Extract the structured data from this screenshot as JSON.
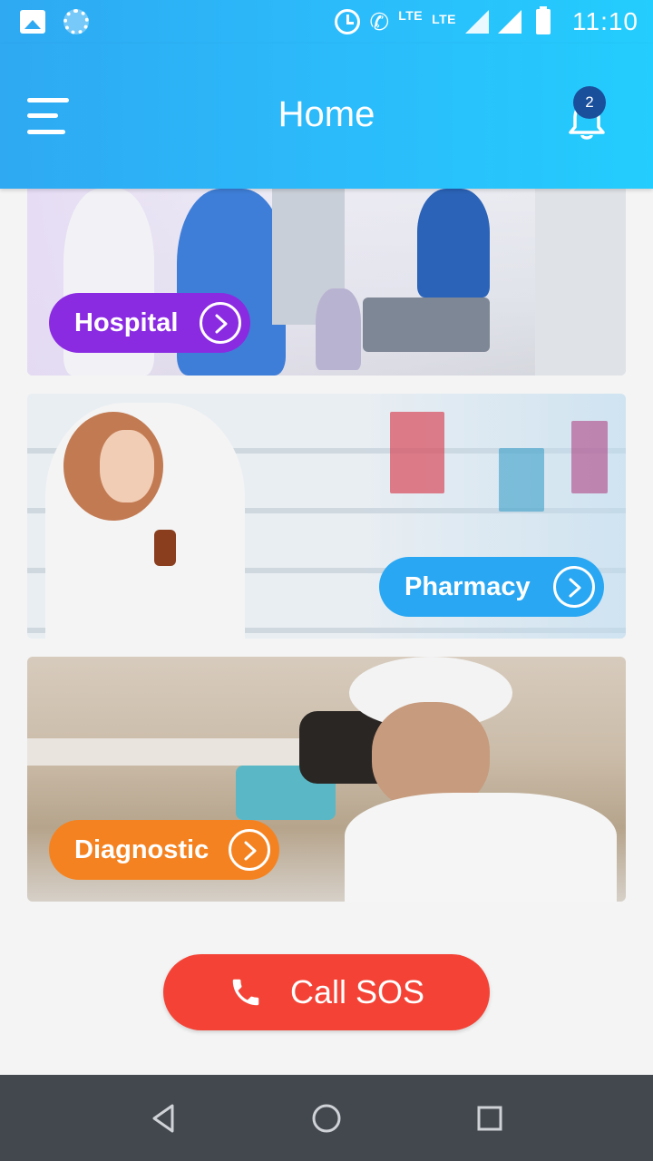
{
  "status_bar": {
    "time": "11:10",
    "lte_1": "LTE",
    "lte_2": "LTE"
  },
  "header": {
    "title": "Home",
    "notification_count": "2"
  },
  "cards": [
    {
      "label": "Hospital",
      "color": "#8a2be2"
    },
    {
      "label": "Pharmacy",
      "color": "#2aa7f2"
    },
    {
      "label": "Diagnostic",
      "color": "#f58220"
    }
  ],
  "sos": {
    "label": "Call SOS",
    "color": "#f44336"
  },
  "icons": {
    "menu": "menu-icon",
    "bell": "bell-icon",
    "arrow": "chevron-right-circle-icon",
    "phone": "phone-icon"
  }
}
